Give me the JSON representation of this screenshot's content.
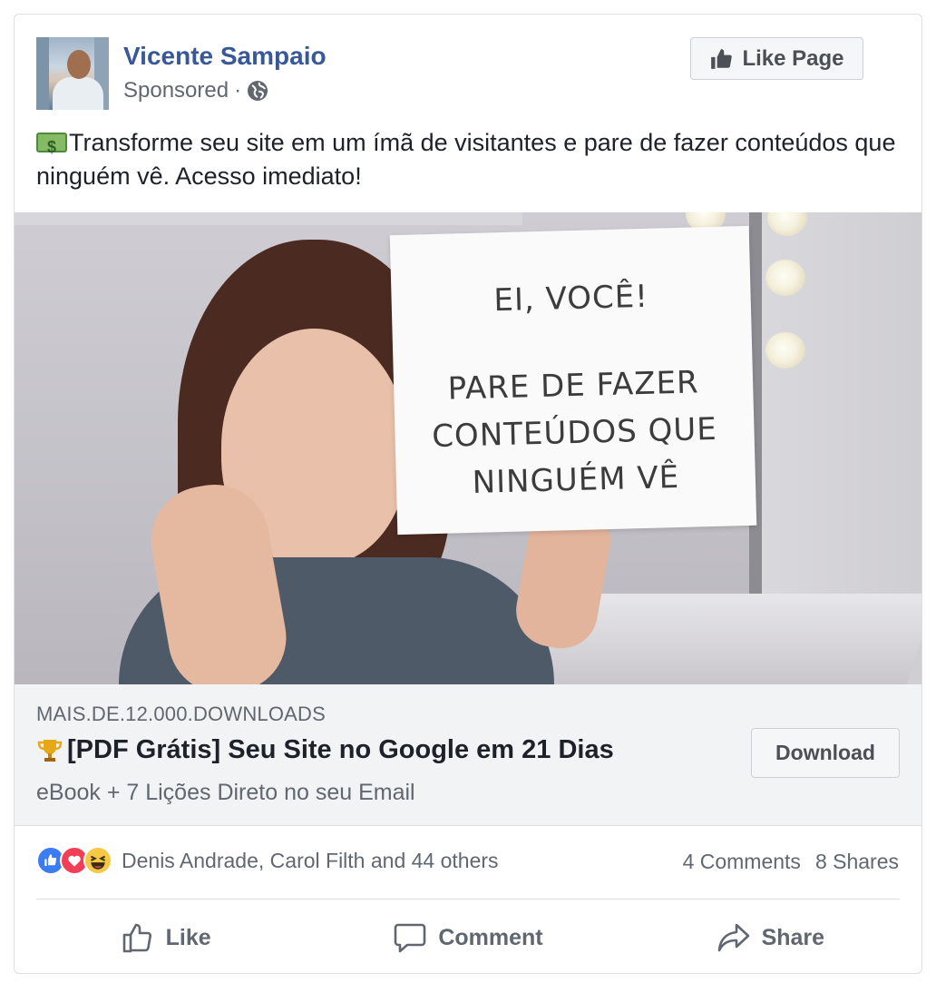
{
  "post": {
    "page_name": "Vicente Sampaio",
    "sponsored_label": "Sponsored",
    "separator": "·",
    "like_page_label": "Like Page",
    "text": "Transforme seu site em um ímã de visitantes e pare de fazer conteúdos que ninguém vê. Acesso imediato!",
    "text_emoji": "money-bill-icon"
  },
  "image": {
    "sign_line1": "EI, VOCÊ!",
    "sign_line2": "PARE DE FAZER CONTEÚDOS QUE NINGUÉM VÊ"
  },
  "link": {
    "domain": "MAIS.DE.12.000.DOWNLOADS",
    "title": "[PDF Grátis] Seu Site no Google em 21 Dias",
    "title_emoji": "trophy-icon",
    "description": "eBook + 7 Lições Direto no seu Email",
    "cta_label": "Download"
  },
  "engagement": {
    "reaction_types": [
      "like",
      "love",
      "haha"
    ],
    "reaction_names": "Denis Andrade, Carol Filth and 44 others",
    "comments": "4 Comments",
    "shares": "8 Shares"
  },
  "actions": {
    "like": "Like",
    "comment": "Comment",
    "share": "Share"
  },
  "colors": {
    "page_name": "#385898",
    "secondary_text": "#606770",
    "link_bg": "#f2f3f5",
    "like_reaction": "#3b7cf2",
    "love_reaction": "#f33e58",
    "haha_reaction": "#f7c844"
  }
}
